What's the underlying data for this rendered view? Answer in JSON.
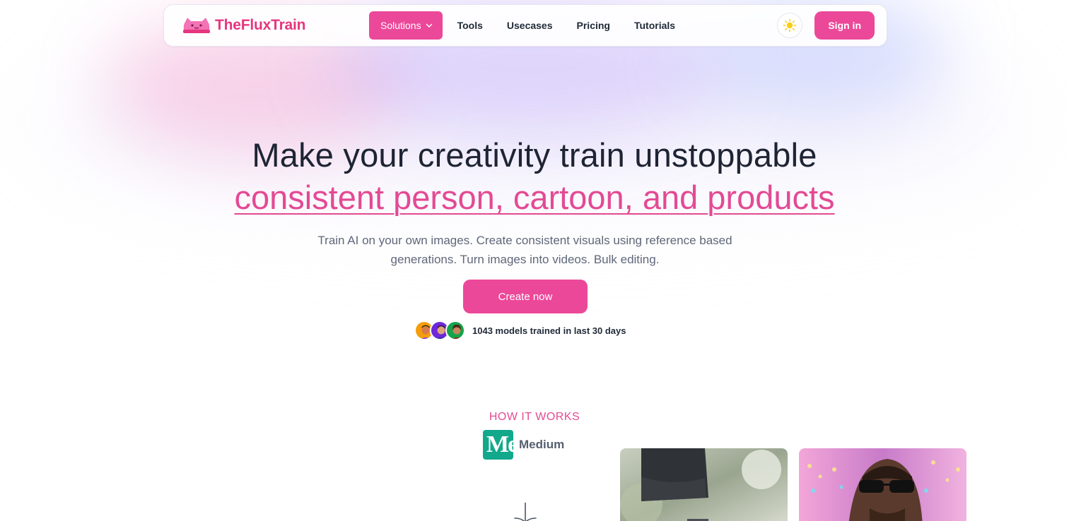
{
  "brand": {
    "name": "TheFluxTrain",
    "accent": "#ec4899",
    "logo_icon": "train-cat-icon"
  },
  "nav": {
    "items": [
      {
        "label": "Solutions",
        "active": true,
        "has_dropdown": true
      },
      {
        "label": "Tools"
      },
      {
        "label": "Usecases"
      },
      {
        "label": "Pricing"
      },
      {
        "label": "Tutorials"
      }
    ],
    "theme_icon": "sun-icon",
    "sign_in_label": "Sign in"
  },
  "hero": {
    "title": "Make your creativity train unstoppable",
    "subtitle": "consistent person, cartoon, and products",
    "description": "Train AI on your own images. Create consistent visuals using reference based generations. Turn images into videos. Bulk editing.",
    "cta_label": "Create now",
    "social_proof": "1043 models trained in last 30 days"
  },
  "how_it_works": {
    "label": "HOW IT WORKS",
    "badge_text": "Medium",
    "badge_icon_glyph": "Me",
    "arrow_icon": "arrow-down-icon"
  }
}
